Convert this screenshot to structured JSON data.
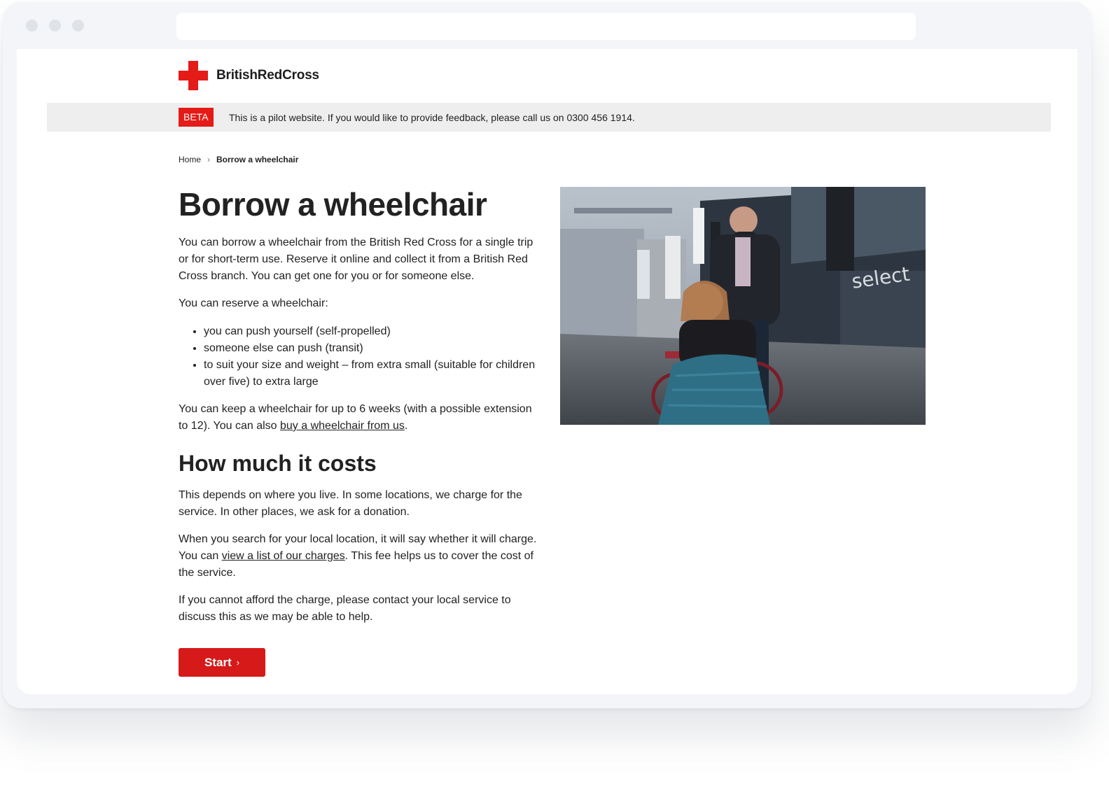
{
  "browser": {
    "url": ""
  },
  "header": {
    "logo_text": "BritishRedCross",
    "beta_tag": "BETA",
    "beta_message": "This is a pilot website. If you would like to provide feedback, please call us on 0300 456 1914."
  },
  "breadcrumb": {
    "home": "Home",
    "separator": "›",
    "current": "Borrow a wheelchair"
  },
  "main": {
    "title": "Borrow a wheelchair",
    "intro": "You can borrow a wheelchair from the British Red Cross for a single trip or for short-term use. Reserve it online and collect it from a British Red Cross branch. You can get one for you or for someone else.",
    "reserve_lead": "You can reserve a wheelchair:",
    "reserve_items": [
      "you can push yourself (self-propelled)",
      "someone else can push (transit)",
      "to suit your size and weight – from extra small (suitable for children over five) to extra large"
    ],
    "keep_text_before": "You can keep a wheelchair for up to 6 weeks (with a possible extension to 12). You can also ",
    "keep_link": "buy a wheelchair from us",
    "keep_text_after": ".",
    "cost_heading": "How much it costs",
    "cost_p1": "This depends on where you live. In some locations, we charge for the service. In other places, we ask for a donation.",
    "cost_p2_before": "When you search for your local location, it will say whether it will charge. You can ",
    "cost_p2_link": "view a list of our charges",
    "cost_p2_after": ". This fee helps us to cover the cost of the service.",
    "cost_p3": "If you cannot afford the charge, please contact your local service to discuss this as we may be able to help.",
    "start_button": "Start",
    "start_chevron": "›"
  },
  "photo": {
    "shop_sign": "select"
  },
  "colors": {
    "brand_red": "#e41b17",
    "button_red": "#d61a1a",
    "beta_bar_bg": "#eeeeee",
    "text": "#222222"
  }
}
